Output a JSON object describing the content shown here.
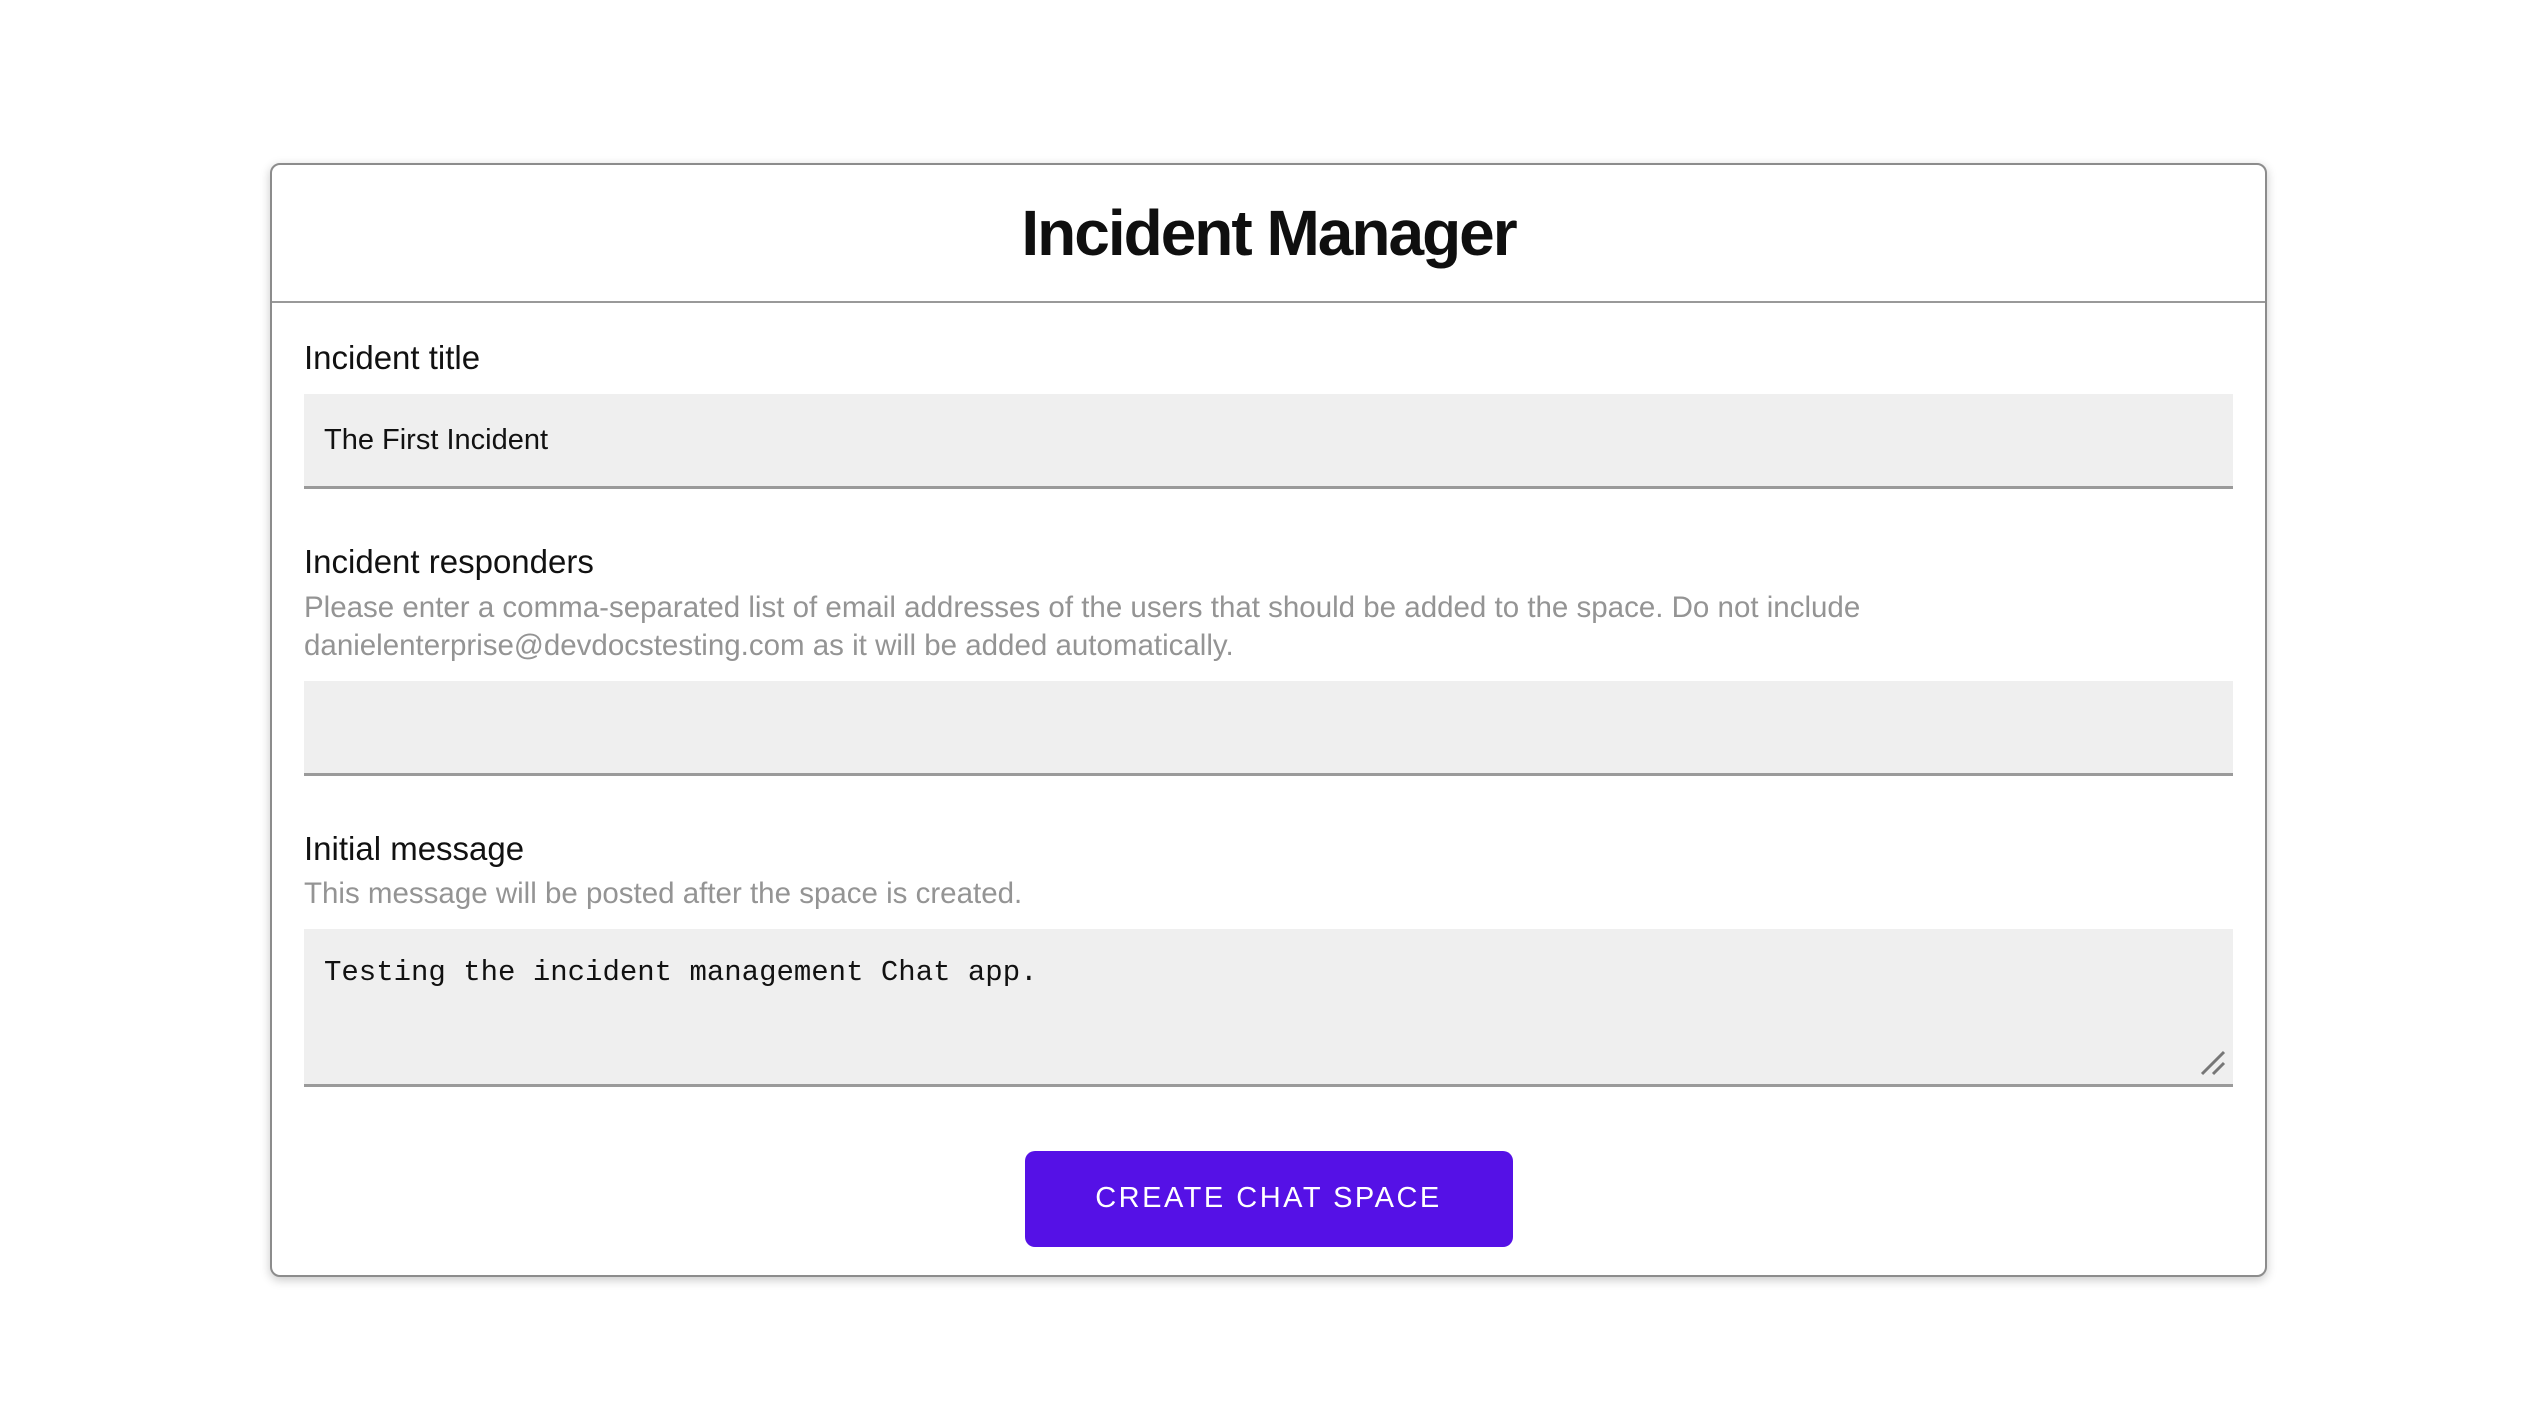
{
  "header": {
    "title": "Incident Manager"
  },
  "form": {
    "fields": [
      {
        "id": "incident-title",
        "label": "Incident title",
        "description": "",
        "value": "The First Incident",
        "type": "input"
      },
      {
        "id": "incident-responders",
        "label": "Incident responders",
        "description": "Please enter a comma-separated list of email addresses of the users that should be added to the space. Do not include danielenterprise@devdocstesting.com as it will be added automatically.",
        "value": "",
        "type": "input"
      },
      {
        "id": "initial-message",
        "label": "Initial message",
        "description": "This message will be posted after the space is created.",
        "value": "Testing the incident management Chat app.",
        "type": "textarea"
      }
    ],
    "submit_label": "CREATE CHAT SPACE"
  },
  "colors": {
    "accent": "#5511e6",
    "field_background": "#efefef",
    "field_border": "#9a9a9a",
    "card_border": "#8c8c8c",
    "description_text": "#949494"
  }
}
